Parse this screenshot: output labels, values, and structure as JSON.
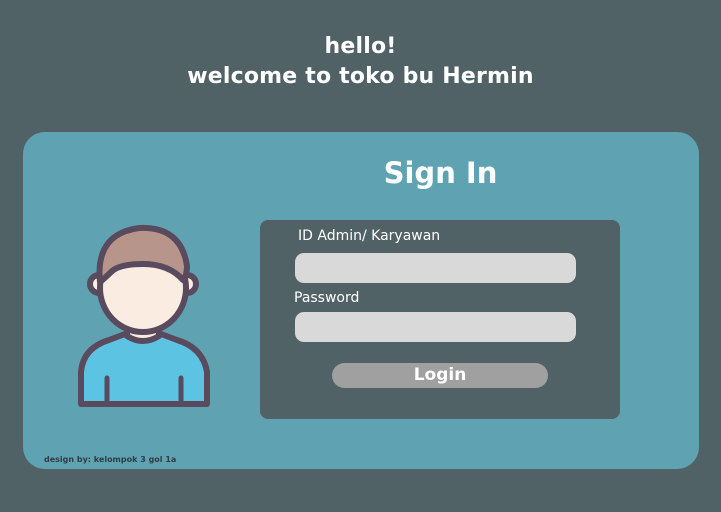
{
  "header": {
    "line1": "hello!",
    "line2": "welcome to toko bu Hermin"
  },
  "card": {
    "title": "Sign In",
    "credit": "design by: kelompok 3 gol 1a"
  },
  "form": {
    "id_label": "ID Admin/ Karyawan",
    "id_value": "",
    "password_label": "Password",
    "password_value": "",
    "login_label": "Login"
  },
  "icons": {
    "avatar": "user-avatar-icon"
  },
  "colors": {
    "background": "#516267",
    "card": "#5fa3b3",
    "panel": "#516267",
    "input": "#d9d9d9",
    "button": "#a0a0a0",
    "avatar_outline": "#5a4a5e",
    "avatar_hair": "#b7958a",
    "avatar_skin": "#fbece2",
    "avatar_shirt": "#5dc3e2"
  }
}
